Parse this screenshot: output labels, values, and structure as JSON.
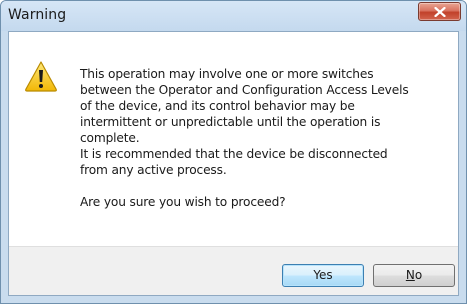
{
  "window": {
    "title": "Warning"
  },
  "dialog": {
    "icon": "warning-triangle-icon",
    "message_lines": [
      "This operation may involve one or more switches",
      "between the Operator and Configuration Access Levels",
      "of the device, and its control behavior may be",
      "intermittent or unpredictable until the operation is",
      "complete.",
      "It is recommended that the device be disconnected",
      "from any active process."
    ],
    "question": "Are you sure you wish to proceed?"
  },
  "buttons": {
    "yes_label": "Yes",
    "no_mnemonic": "N",
    "no_rest": "o"
  },
  "colors": {
    "titlebar": "#c4d9ee",
    "close_button": "#c1412a",
    "default_button_border": "#3c7fb1",
    "warning_yellow": "#f6c813"
  }
}
